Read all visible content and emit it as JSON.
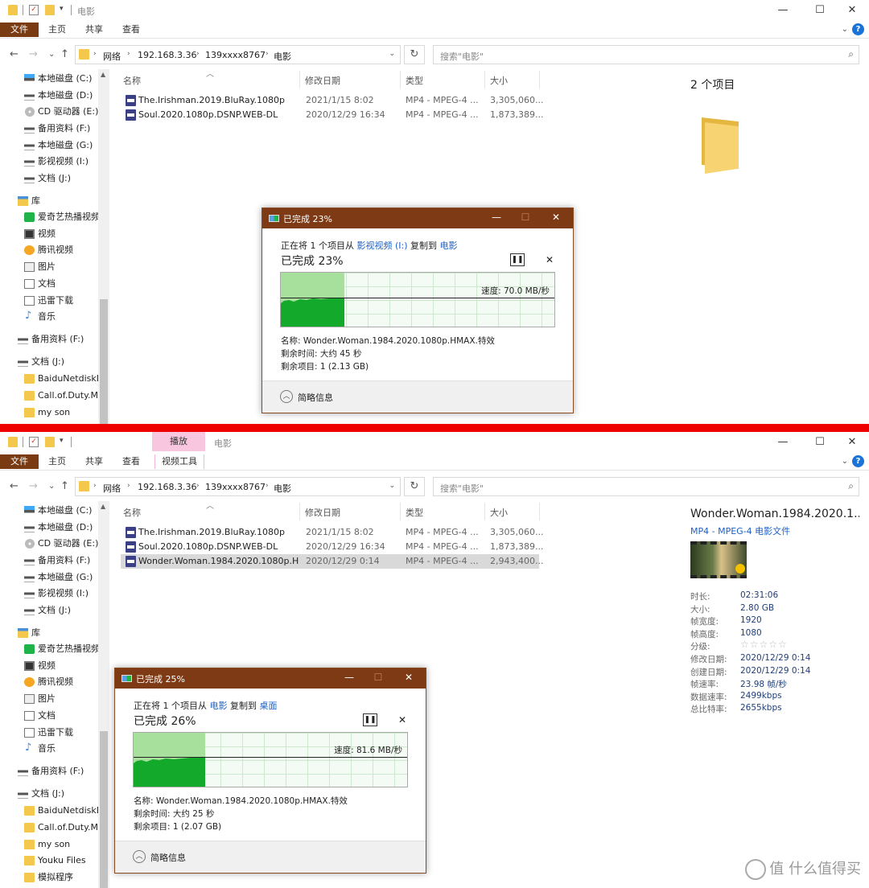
{
  "window_title": "电影",
  "ribbon_tabs": {
    "file": "文件",
    "home": "主页",
    "share": "共享",
    "view": "查看"
  },
  "ribbon_context": {
    "group": "播放",
    "tab": "视频工具"
  },
  "nav": {
    "back": "←",
    "forward": "→",
    "recent": "⌄",
    "up": "↑",
    "refresh": "↻"
  },
  "breadcrumb": [
    "网络",
    "192.168.3.36",
    "139xxxx8767",
    "电影"
  ],
  "search_placeholder": "搜索\"电影\"",
  "sidebar_top": [
    {
      "label": "本地磁盘 (C:)",
      "icon": "system-drive-icon"
    },
    {
      "label": "本地磁盘 (D:)",
      "icon": "drive-icon"
    },
    {
      "label": "CD 驱动器 (E:)",
      "icon": "cd-drive-icon"
    },
    {
      "label": "备用资料 (F:)",
      "icon": "drive-icon"
    },
    {
      "label": "本地磁盘 (G:)",
      "icon": "drive-icon"
    },
    {
      "label": "影视视频 (I:)",
      "icon": "drive-icon"
    },
    {
      "label": "文档 (J:)",
      "icon": "drive-icon"
    }
  ],
  "library_label": "库",
  "libraries": [
    {
      "label": "爱奇艺热播视频",
      "icon": "iqiyi-icon"
    },
    {
      "label": "视频",
      "icon": "video-library-icon"
    },
    {
      "label": "腾讯视频",
      "icon": "tencent-video-icon"
    },
    {
      "label": "图片",
      "icon": "pictures-icon"
    },
    {
      "label": "文档",
      "icon": "documents-icon"
    },
    {
      "label": "迅雷下载",
      "icon": "xunlei-icon"
    },
    {
      "label": "音乐",
      "icon": "music-icon"
    }
  ],
  "network_drives": [
    "备用资料 (F:)",
    "文档 (J:)"
  ],
  "j_folders_top": [
    "BaiduNetdiskD",
    "Call.of.Duty.Mc",
    "my son"
  ],
  "j_folders_bottom": [
    "BaiduNetdiskD",
    "Call.of.Duty.Mc",
    "my son",
    "Youku Files",
    "模拟程序"
  ],
  "columns": {
    "name": "名称",
    "date": "修改日期",
    "type": "类型",
    "size": "大小"
  },
  "files_top": [
    {
      "name": "The.Irishman.2019.BluRay.1080p",
      "date": "2021/1/15 8:02",
      "type": "MP4 - MPEG-4 ...",
      "size": "3,305,060..."
    },
    {
      "name": "Soul.2020.1080p.DSNP.WEB-DL",
      "date": "2020/12/29 16:34",
      "type": "MP4 - MPEG-4 ...",
      "size": "1,873,389..."
    }
  ],
  "files_bottom": [
    {
      "name": "The.Irishman.2019.BluRay.1080p",
      "date": "2021/1/15 8:02",
      "type": "MP4 - MPEG-4 ...",
      "size": "3,305,060..."
    },
    {
      "name": "Soul.2020.1080p.DSNP.WEB-DL",
      "date": "2020/12/29 16:34",
      "type": "MP4 - MPEG-4 ...",
      "size": "1,873,389..."
    },
    {
      "name": "Wonder.Woman.1984.2020.1080p.H...",
      "date": "2020/12/29 0:14",
      "type": "MP4 - MPEG-4 ...",
      "size": "2,943,400..."
    }
  ],
  "preview_top": {
    "count": "2 个项目"
  },
  "details": {
    "title": "Wonder.Woman.1984.2020.1...",
    "type": "MP4 - MPEG-4 电影文件",
    "props": [
      {
        "k": "时长:",
        "v": "02:31:06"
      },
      {
        "k": "大小:",
        "v": "2.80 GB"
      },
      {
        "k": "帧宽度:",
        "v": "1920"
      },
      {
        "k": "帧高度:",
        "v": "1080"
      },
      {
        "k": "分级:",
        "v": "☆☆☆☆☆"
      },
      {
        "k": "修改日期:",
        "v": "2020/12/29 0:14"
      },
      {
        "k": "创建日期:",
        "v": "2020/12/29 0:14"
      },
      {
        "k": "帧速率:",
        "v": "23.98 帧/秒"
      },
      {
        "k": "数据速率:",
        "v": "2499kbps"
      },
      {
        "k": "总比特率:",
        "v": "2655kbps"
      }
    ]
  },
  "dialog_top": {
    "title": "已完成 23%",
    "copy_prefix": "正在将 1 个项目从",
    "src": "影视视频 (I:)",
    "mid": "复制到",
    "dst": "电影",
    "pct": "已完成 23%",
    "progress": 0.23,
    "speed": "速度: 70.0 MB/秒",
    "name": "名称: Wonder.Woman.1984.2020.1080p.HMAX.特效",
    "remaining_time": "剩余时间: 大约 45 秒",
    "remaining_items": "剩余项目: 1 (2.13 GB)",
    "details": "简略信息"
  },
  "dialog_bottom": {
    "title": "已完成 25%",
    "copy_prefix": "正在将 1 个项目从",
    "src": "电影",
    "mid": "复制到",
    "dst": "桌面",
    "pct": "已完成 26%",
    "progress": 0.26,
    "speed": "速度: 81.6 MB/秒",
    "name": "名称: Wonder.Woman.1984.2020.1080p.HMAX.特效",
    "remaining_time": "剩余时间: 大约 25 秒",
    "remaining_items": "剩余项目: 1 (2.07 GB)",
    "details": "简略信息"
  },
  "window_controls": {
    "min": "—",
    "max": "☐",
    "close": "✕"
  },
  "watermark": "值 什么值得买"
}
